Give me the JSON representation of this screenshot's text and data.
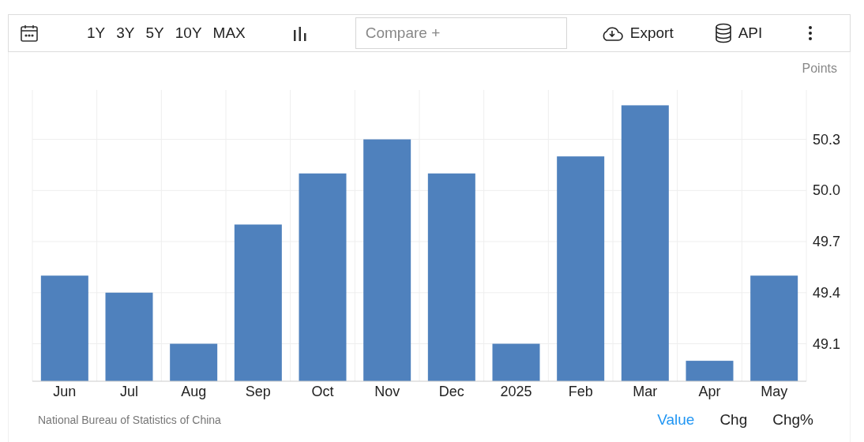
{
  "toolbar": {
    "ranges": [
      {
        "label": "1Y",
        "selected": false
      },
      {
        "label": "3Y",
        "selected": false
      },
      {
        "label": "5Y",
        "selected": false
      },
      {
        "label": "10Y",
        "selected": false
      },
      {
        "label": "MAX",
        "selected": false
      }
    ],
    "compare": {
      "placeholder": "Compare +"
    },
    "export": "Export",
    "api": "API"
  },
  "unit": "Points",
  "chart": {
    "chart_data": {
      "type": "bar",
      "categories": [
        "Jun",
        "Jul",
        "Aug",
        "Sep",
        "Oct",
        "Nov",
        "Dec",
        "2025",
        "Feb",
        "Mar",
        "Apr",
        "May"
      ],
      "grid": true,
      "series": [
        {
          "color": "#4f81bd",
          "values": [
            49.5,
            49.4,
            49.1,
            49.8,
            50.1,
            50.3,
            50.1,
            49.1,
            50.2,
            50.5,
            49.0,
            49.5
          ]
        }
      ],
      "ylim": [
        48.88,
        50.59
      ],
      "yticks": [
        {
          "value": 49.1,
          "label": "49.1"
        },
        {
          "value": 49.4,
          "label": "49.4"
        },
        {
          "value": 49.7,
          "label": "49.7"
        },
        {
          "value": 50.0,
          "label": "50.0"
        },
        {
          "value": 50.3,
          "label": "50.3"
        }
      ]
    }
  },
  "source": "National Bureau of Statistics of China",
  "views": [
    {
      "label": "Value",
      "selected": true
    },
    {
      "label": "Chg",
      "selected": false
    },
    {
      "label": "Chg%",
      "selected": false
    }
  ]
}
